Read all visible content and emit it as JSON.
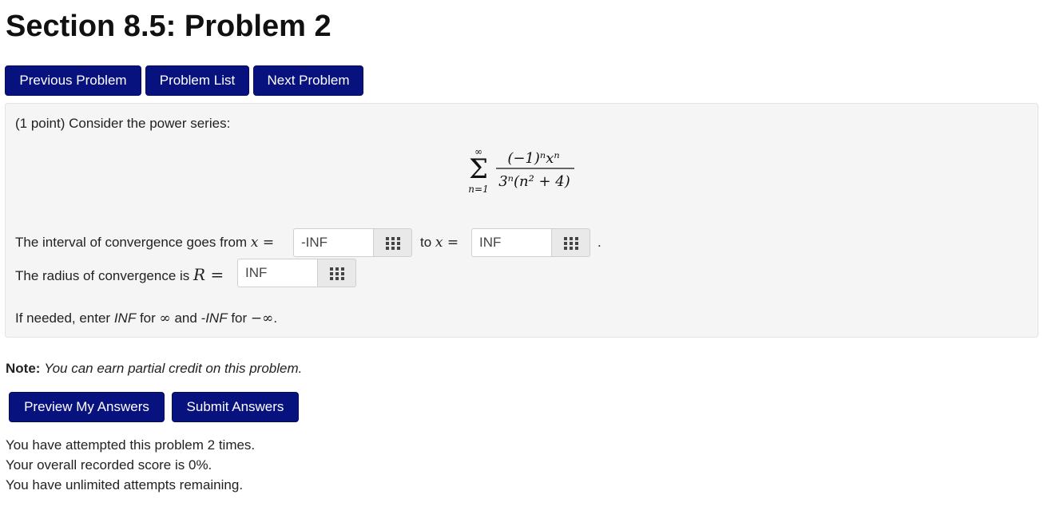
{
  "page": {
    "title": "Section 8.5: Problem 2"
  },
  "nav": {
    "previous_label": "Previous Problem",
    "list_label": "Problem List",
    "next_label": "Next Problem"
  },
  "problem": {
    "intro": "(1 point) Consider the power series:",
    "interval_prefix": "The interval of convergence goes from",
    "interval_mid": "to",
    "interval_end": ".",
    "radius_prefix": "The radius of convergence is",
    "hint_pre": "If needed, enter",
    "hint_inf": "INF",
    "hint_for1": "for",
    "hint_and": "and",
    "hint_neginf": "-INF",
    "hint_for2": "for"
  },
  "math": {
    "x_equals": "x =",
    "r_equals": "R =",
    "infinity": "∞",
    "neg_infinity": "−∞",
    "sum_upper": "∞",
    "sum_symbol": "Σ",
    "sum_lower": "n=1",
    "numerator": "(−1)ⁿxⁿ",
    "denominator": "3ⁿ(n² + 4)"
  },
  "answers": {
    "from_value": "-INF",
    "to_value": "INF",
    "radius_value": "INF"
  },
  "note": {
    "label": "Note:",
    "text": "You can earn partial credit on this problem."
  },
  "actions": {
    "preview_label": "Preview My Answers",
    "submit_label": "Submit Answers"
  },
  "status": {
    "attempts": "You have attempted this problem 2 times.",
    "score": "Your overall recorded score is 0%.",
    "remaining": "You have unlimited attempts remaining."
  },
  "colors": {
    "button_bg": "#08127f",
    "panel_bg": "#f5f5f5"
  }
}
